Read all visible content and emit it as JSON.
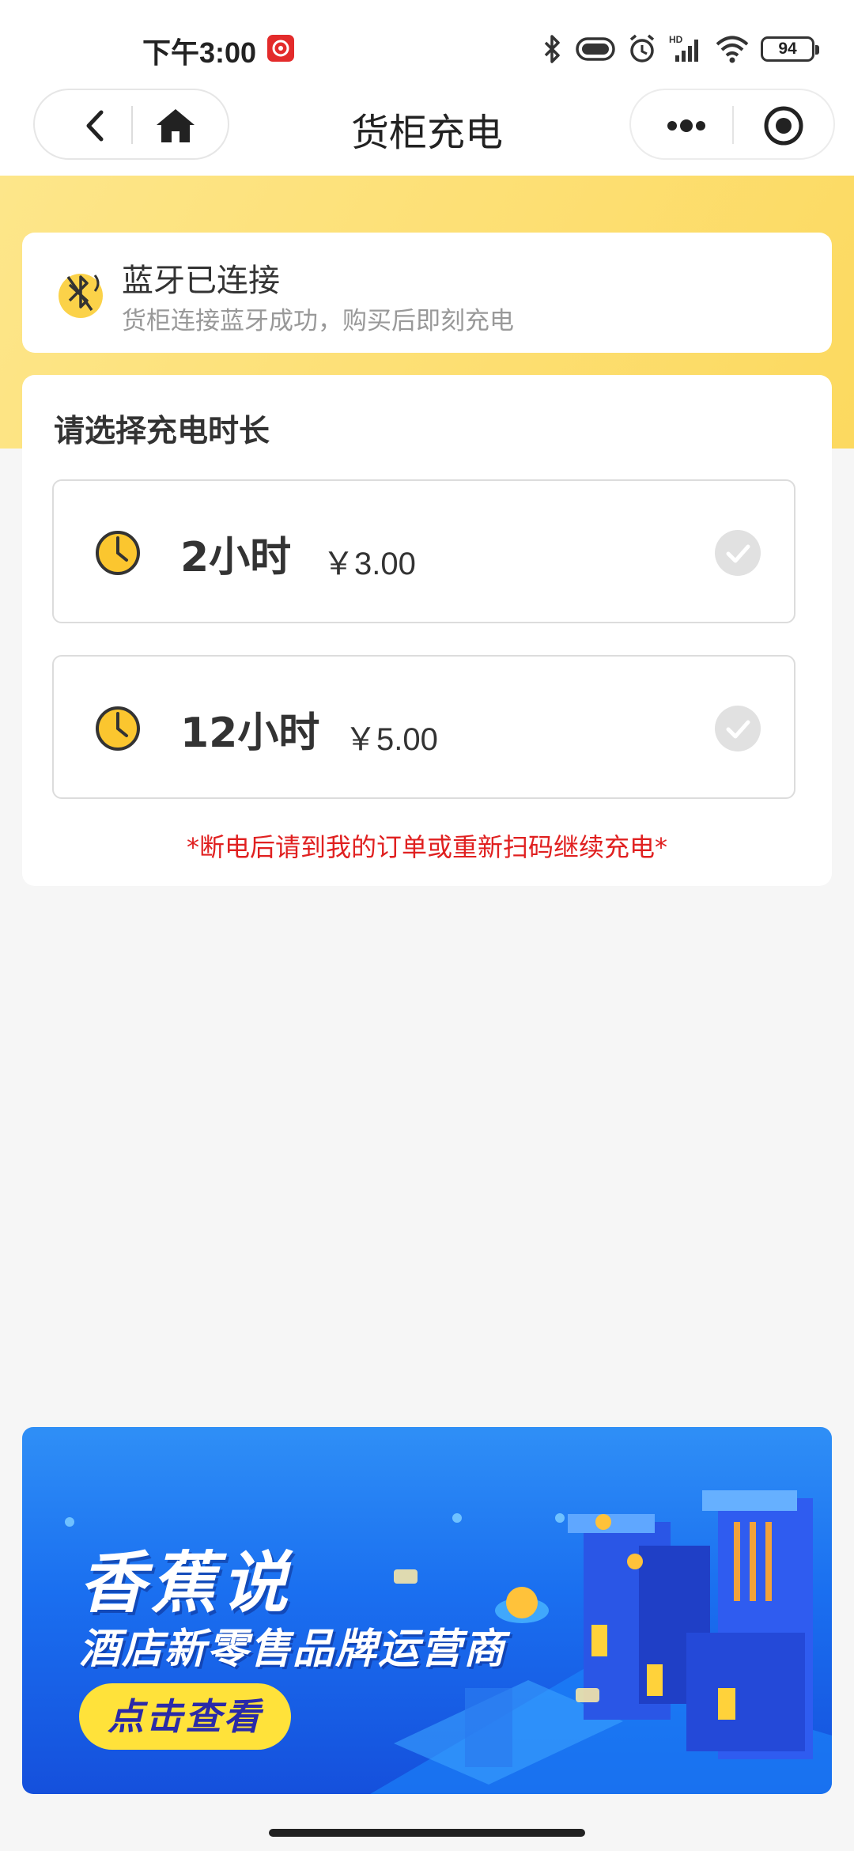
{
  "status_bar": {
    "time": "下午3:00",
    "battery": "94"
  },
  "nav": {
    "title": "货柜充电"
  },
  "bluetooth": {
    "title": "蓝牙已连接",
    "subtitle": "货柜连接蓝牙成功，购买后即刻充电"
  },
  "charge": {
    "section_title": "请选择充电时长",
    "options": [
      {
        "duration": "2小时",
        "price": "￥3.00"
      },
      {
        "duration": "12小时",
        "price": "￥5.00"
      }
    ],
    "notice": "*断电后请到我的订单或重新扫码继续充电*"
  },
  "banner": {
    "brand": "香蕉说",
    "slogan": "酒店新零售品牌运营商",
    "cta": "点击查看"
  },
  "colors": {
    "accent_yellow": "#fddf73",
    "notice_red": "#e02020",
    "banner_blue": "#1a6ff0"
  }
}
